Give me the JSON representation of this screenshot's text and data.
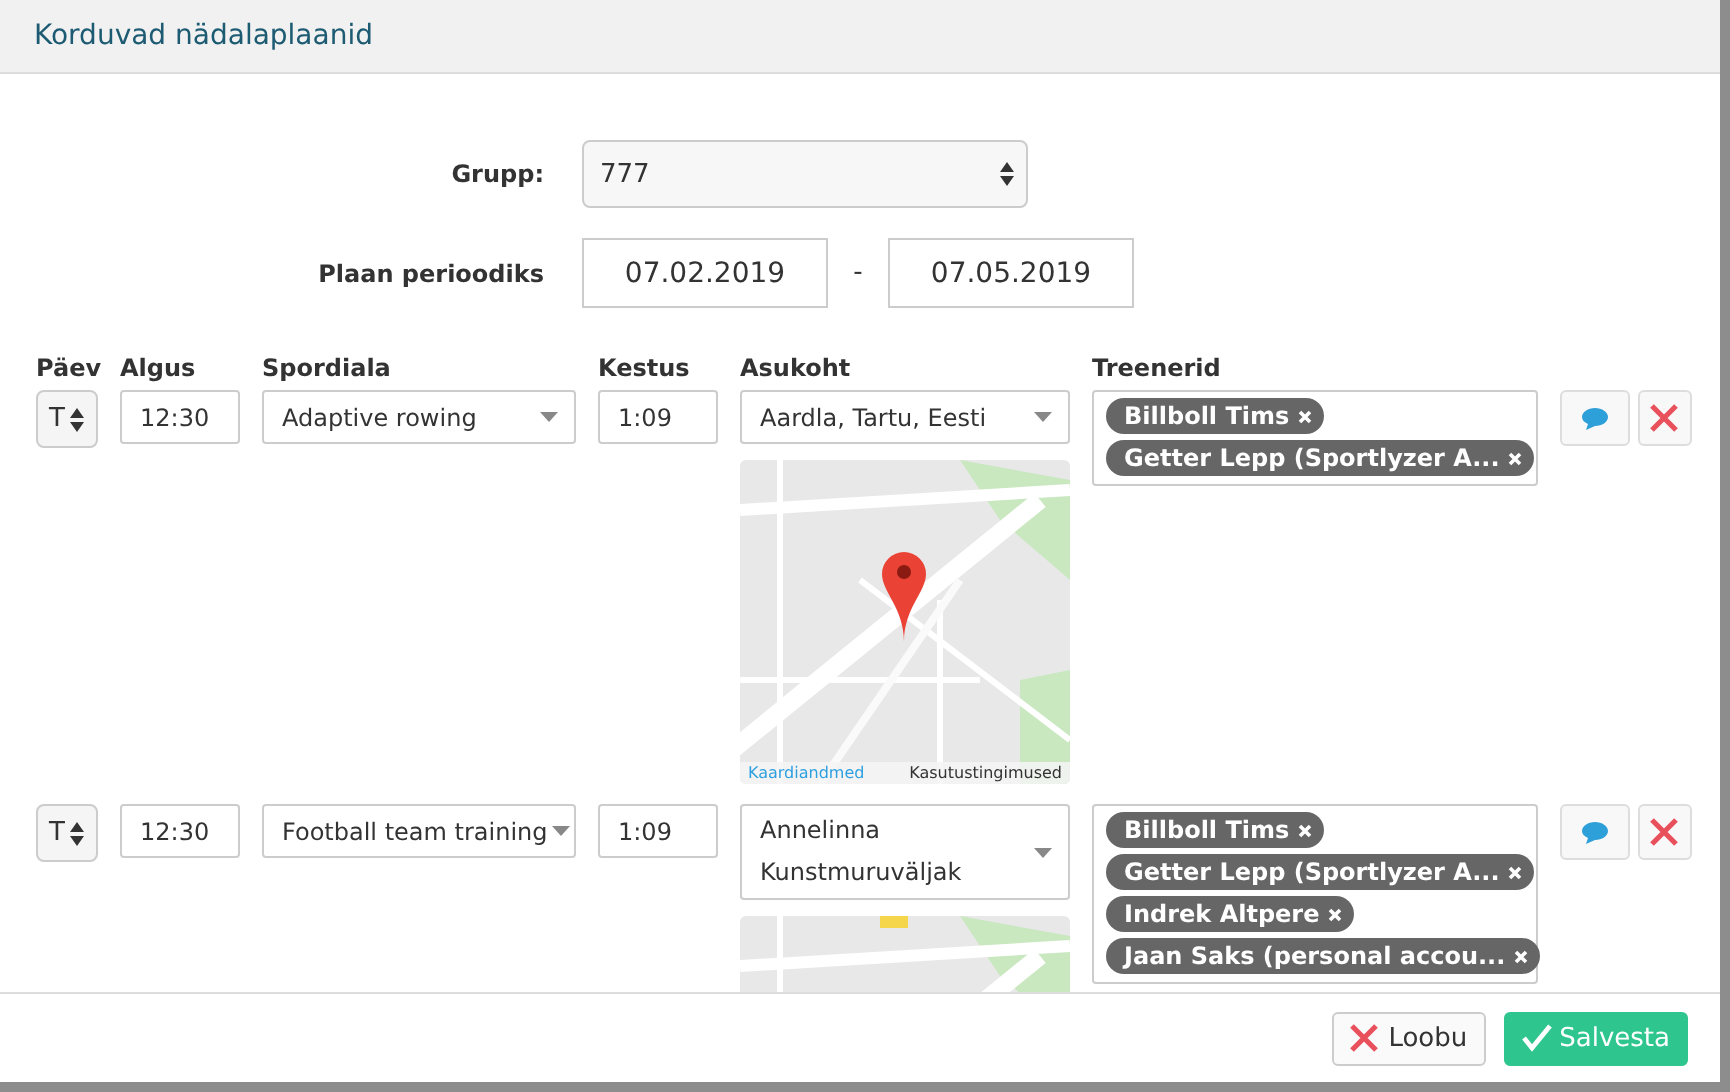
{
  "window": {
    "title": "Korduvad nädalaplaanid"
  },
  "group": {
    "label": "Grupp:",
    "value": "777"
  },
  "period": {
    "label": "Plaan perioodiks",
    "start": "07.02.2019",
    "separator": "-",
    "end": "07.05.2019"
  },
  "columns": [
    "Päev",
    "Algus",
    "Spordiala",
    "Kestus",
    "Asukoht",
    "Treenerid"
  ],
  "rows": [
    {
      "day": "T",
      "start": "12:30",
      "sport": "Adaptive rowing",
      "duration": "1:09",
      "location": "Aardla, Tartu, Eesti",
      "map": {
        "kind": "picture",
        "attribution": [
          "Kaardiandmed",
          "Kasutustingimused"
        ]
      },
      "trainers": [
        "Billboll Tims",
        "Getter Lepp (Sportlyzer A..."
      ]
    },
    {
      "day": "T",
      "start": "12:30",
      "sport": "Football team training",
      "duration": "1:09",
      "location": "Annelinna Kunstmuruväljak",
      "trainers": [
        "Billboll Tims",
        "Getter Lepp (Sportlyzer A...",
        "Indrek Altpere",
        "Jaan Saks (personal accou..."
      ]
    }
  ],
  "buttons": [
    {
      "kind": "cancel",
      "label": "Loobu"
    },
    {
      "kind": "save",
      "label": "Salvesta"
    }
  ]
}
